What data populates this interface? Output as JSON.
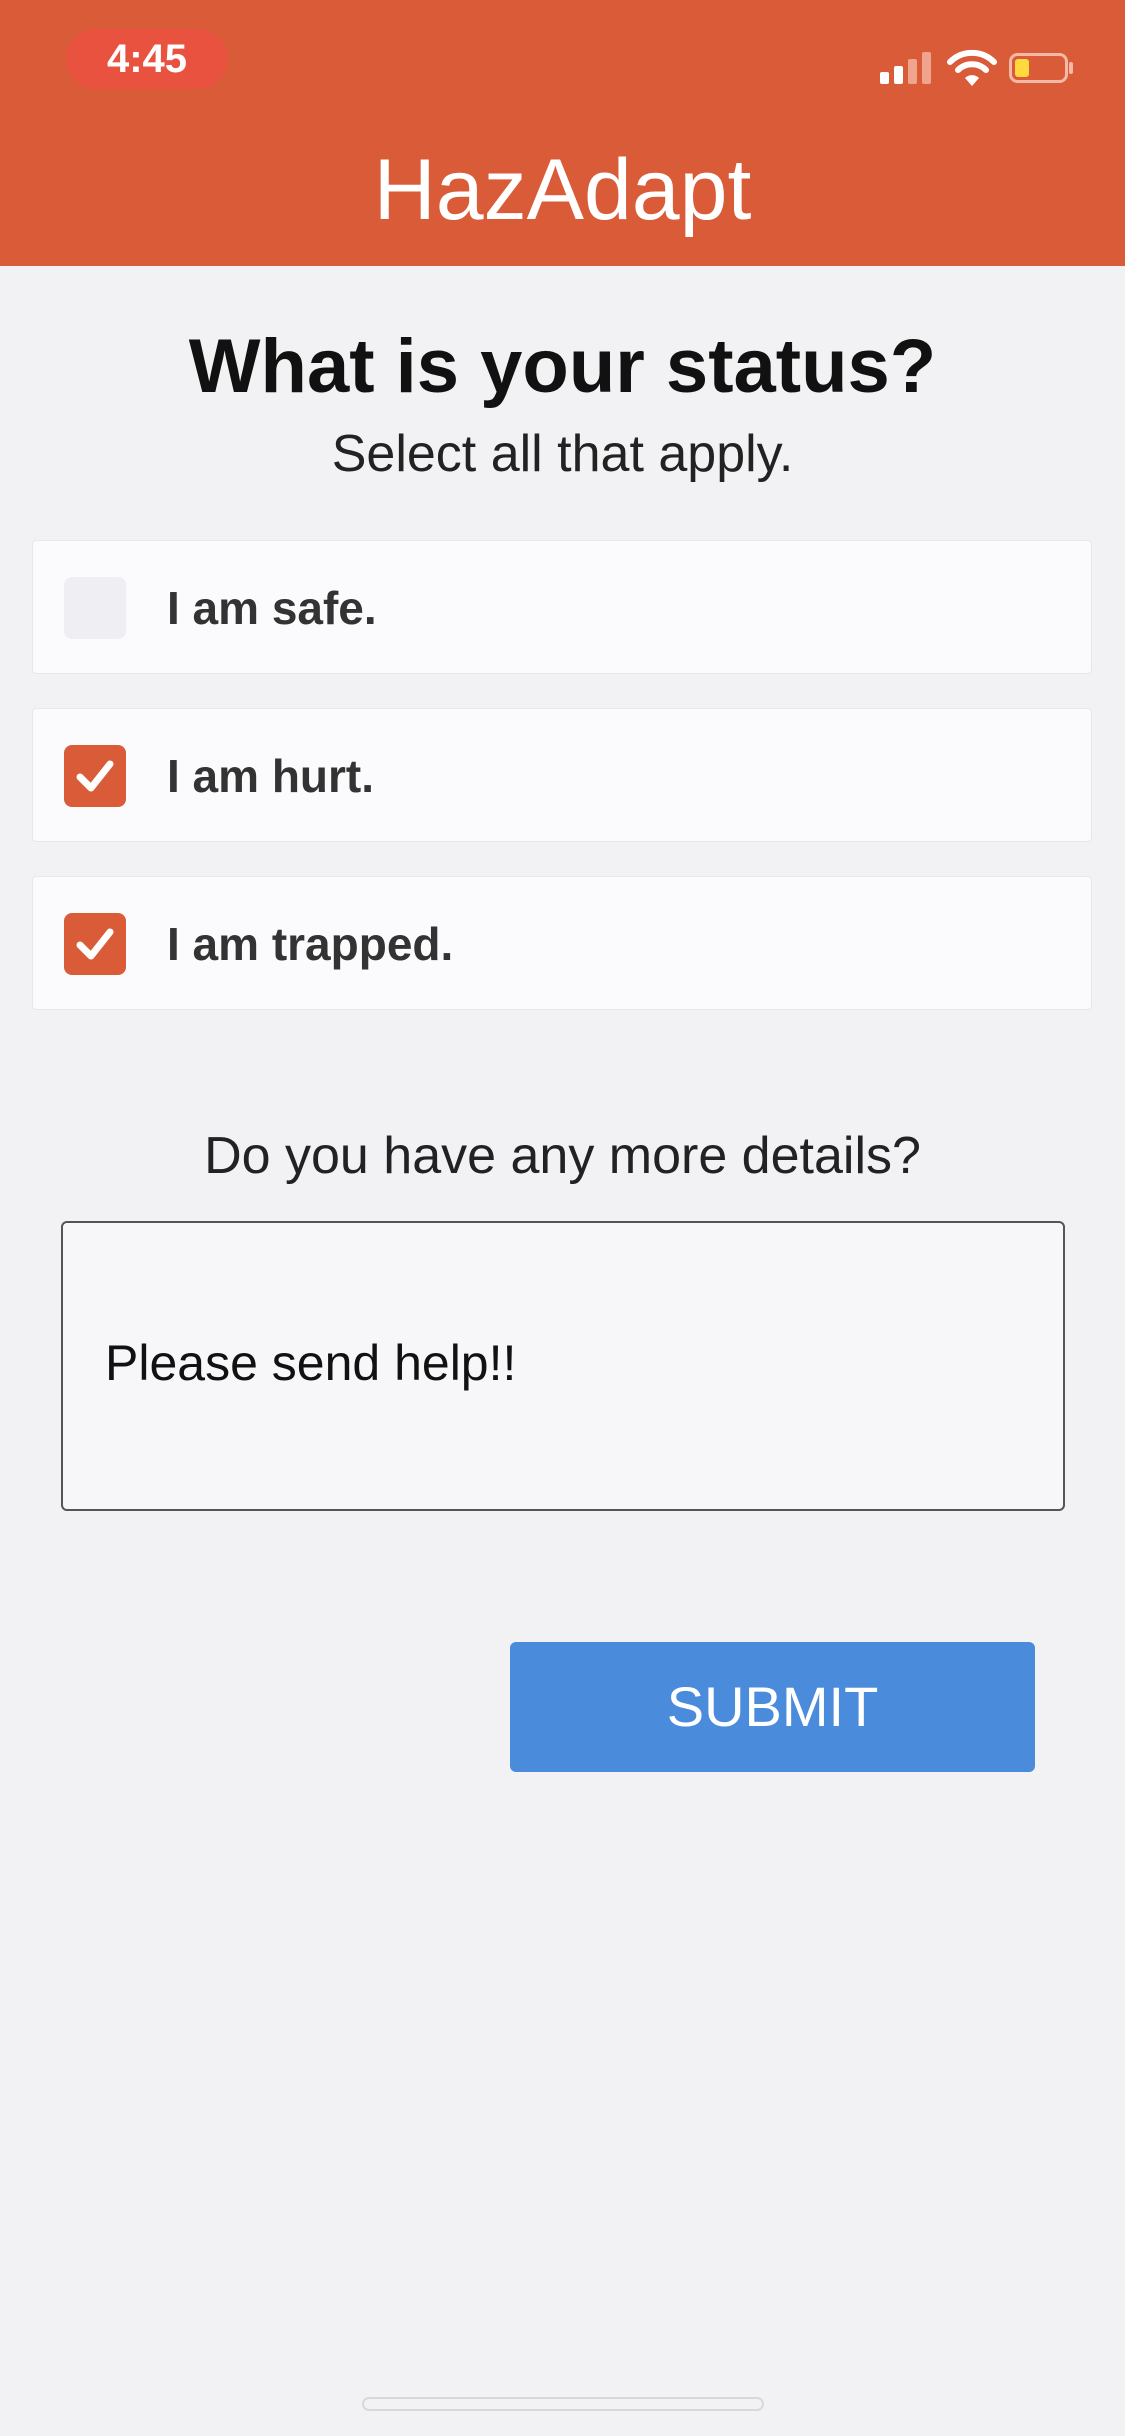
{
  "status_bar": {
    "time": "4:45",
    "icons": [
      "cellular-signal-icon",
      "wifi-icon",
      "battery-icon"
    ]
  },
  "header": {
    "title": "HazAdapt"
  },
  "main": {
    "question": "What is your status?",
    "subtitle": "Select all that apply.",
    "options": [
      {
        "label": "I am safe.",
        "checked": false
      },
      {
        "label": "I am hurt.",
        "checked": true
      },
      {
        "label": "I am trapped.",
        "checked": true
      }
    ],
    "details_label": "Do you have any more details?",
    "details_value": "Please send help!!",
    "submit_label": "SUBMIT"
  },
  "colors": {
    "header_bg": "#d95b37",
    "checkbox_checked": "#d95b37",
    "submit_bg": "#4a8bdc",
    "page_bg": "#f2f2f5"
  }
}
